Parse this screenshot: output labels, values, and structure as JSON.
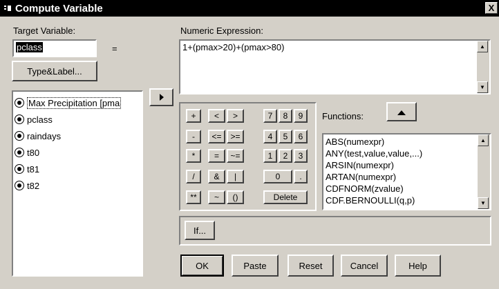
{
  "window": {
    "title": "Compute Variable",
    "close_label": "X"
  },
  "target": {
    "label": "Target Variable:",
    "value": "pclass",
    "equals": "=",
    "type_label_button": "Type&Label..."
  },
  "variables": [
    {
      "label": "Max Precipitation [pma",
      "icon": "numeric-variable-icon",
      "selected": true
    },
    {
      "label": "pclass",
      "icon": "numeric-variable-icon"
    },
    {
      "label": "raindays",
      "icon": "numeric-variable-icon"
    },
    {
      "label": "t80",
      "icon": "numeric-variable-icon"
    },
    {
      "label": "t81",
      "icon": "numeric-variable-icon"
    },
    {
      "label": "t82",
      "icon": "numeric-variable-icon"
    }
  ],
  "expression": {
    "label": "Numeric Expression:",
    "value": "1+(pmax>20)+(pmax>80)"
  },
  "keypad": {
    "ops": [
      "+",
      "<",
      ">",
      "-",
      "<=",
      ">=",
      "*",
      "=",
      "~=",
      "/",
      "&",
      "|",
      "**",
      "~",
      "()"
    ],
    "digits": [
      "7",
      "8",
      "9",
      "4",
      "5",
      "6",
      "1",
      "2",
      "3",
      "0",
      "."
    ],
    "delete": "Delete"
  },
  "functions": {
    "label": "Functions:",
    "items": [
      "ABS(numexpr)",
      "ANY(test,value,value,...)",
      "ARSIN(numexpr)",
      "ARTAN(numexpr)",
      "CDFNORM(zvalue)",
      "CDF.BERNOULLI(q,p)"
    ]
  },
  "if_button": "If...",
  "buttons": {
    "ok": "OK",
    "paste": "Paste",
    "reset": "Reset",
    "cancel": "Cancel",
    "help": "Help"
  }
}
